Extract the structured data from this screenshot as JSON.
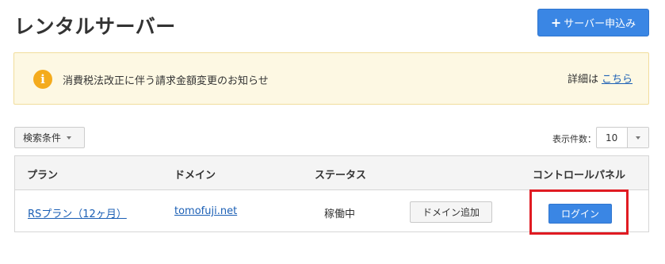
{
  "page": {
    "title": "レンタルサーバー",
    "apply_button": {
      "icon": "plus-icon",
      "label": "サーバー申込み"
    }
  },
  "notice": {
    "icon": "info-icon",
    "icon_glyph": "i",
    "text": "消費税法改正に伴う請求金額変更のお知らせ",
    "detail_label": "詳細は",
    "detail_link": "こちら"
  },
  "filters": {
    "search_label": "検索条件",
    "count_label": "表示件数：",
    "count_value": "10"
  },
  "table": {
    "headers": [
      "プラン",
      "ドメイン",
      "ステータス",
      "",
      "コントロールパネル"
    ],
    "rows": [
      {
        "plan": "RSプラン（12ヶ月）",
        "domain": "tomofuji.net",
        "status": "稼働中",
        "add_domain_label": "ドメイン追加",
        "login_label": "ログイン"
      }
    ]
  },
  "colors": {
    "primary": "#3a86e4",
    "notice_bg": "#fdf8e3",
    "info_icon": "#f4ab1d",
    "link": "#1b5fb5",
    "highlight": "#e01b22"
  }
}
